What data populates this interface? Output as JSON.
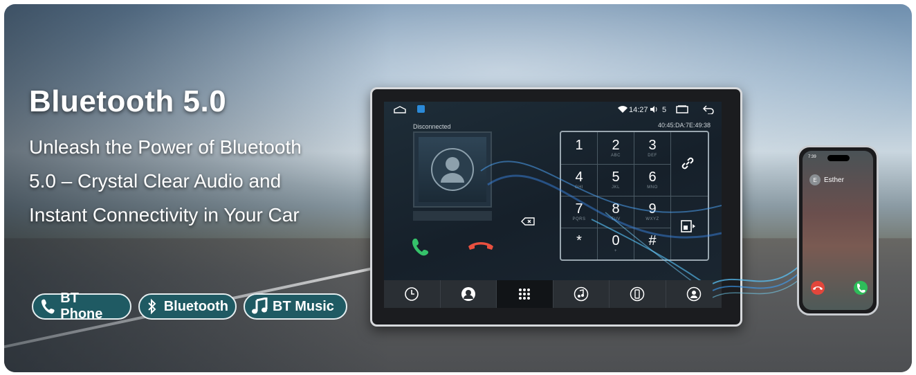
{
  "headline": "Bluetooth 5.0",
  "subline": "Unleash the Power of Bluetooth 5.0 – Crystal Clear Audio and Instant Connectivity in Your Car",
  "pills": [
    {
      "label": "BT Phone",
      "icon": "phone-icon"
    },
    {
      "label": "Bluetooth",
      "icon": "bluetooth-icon"
    },
    {
      "label": "BT Music",
      "icon": "music-note-icon"
    }
  ],
  "head_unit": {
    "status": {
      "time": "14:27",
      "volume": "5"
    },
    "connection_status": "Disconnected",
    "mac_address": "40:45:DA:7E:49:38",
    "keypad": [
      {
        "n": "1",
        "l": ""
      },
      {
        "n": "2",
        "l": "ABC"
      },
      {
        "n": "3",
        "l": "DEF"
      },
      {
        "n": "4",
        "l": "GHI"
      },
      {
        "n": "5",
        "l": "JKL"
      },
      {
        "n": "6",
        "l": "MNO"
      },
      {
        "n": "7",
        "l": "PQRS"
      },
      {
        "n": "8",
        "l": "TUV"
      },
      {
        "n": "9",
        "l": "WXYZ"
      },
      {
        "n": "*",
        "l": ""
      },
      {
        "n": "0",
        "l": "+"
      },
      {
        "n": "#",
        "l": ""
      }
    ],
    "tabs": [
      "clock-icon",
      "contacts-icon",
      "dialpad-icon",
      "music-icon",
      "phone-device-icon",
      "settings-icon"
    ]
  },
  "phone": {
    "caller_name": "Esther",
    "caller_initial": "E",
    "status_time": "7:39"
  },
  "colors": {
    "pill_bg": "#1f5a63",
    "accept": "#2ebd5a",
    "decline": "#e2463b"
  }
}
